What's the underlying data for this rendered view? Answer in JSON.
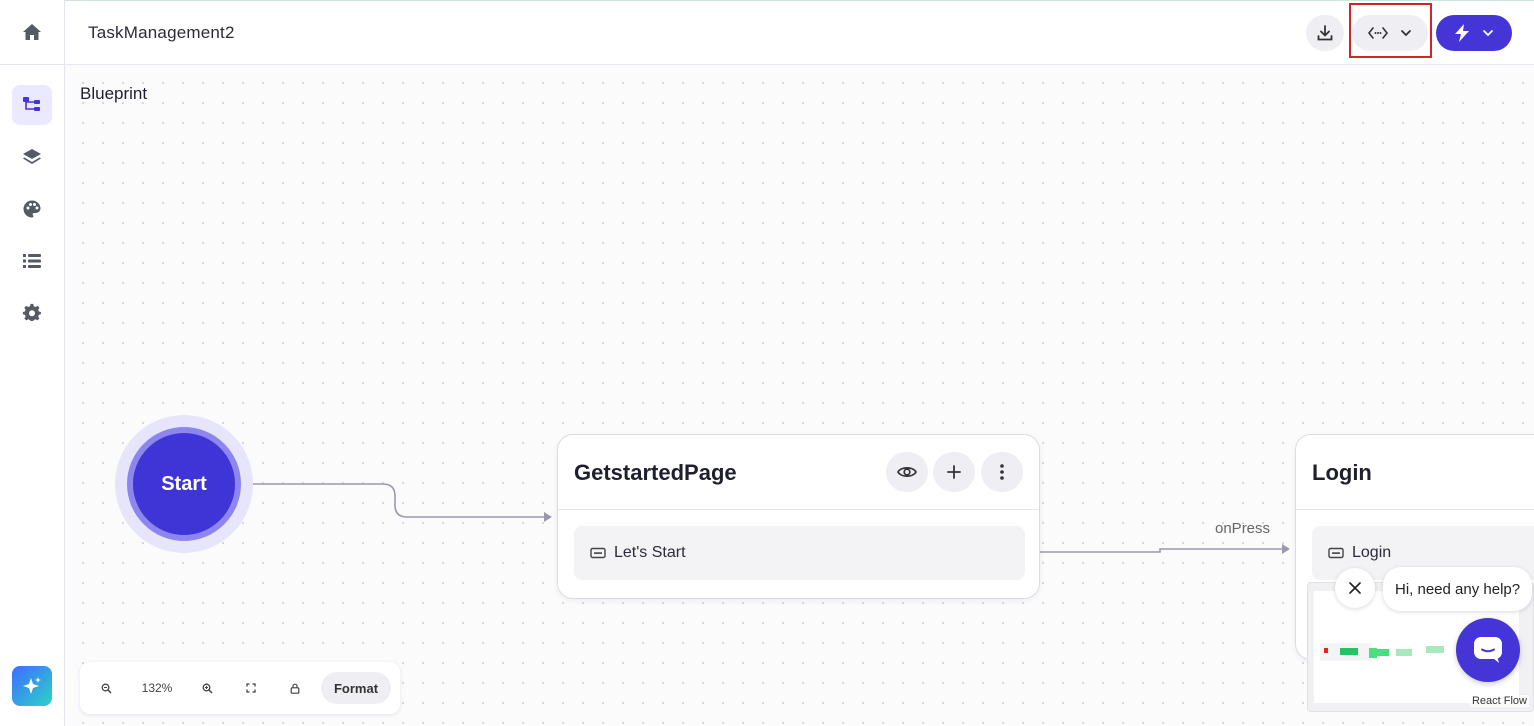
{
  "header": {
    "project_title": "TaskManagement2",
    "accent_color": "#4535d6"
  },
  "sidebar": {
    "items": [
      {
        "icon": "home-icon"
      },
      {
        "icon": "blueprint-icon",
        "active": true
      },
      {
        "icon": "layers-icon"
      },
      {
        "icon": "palette-icon"
      },
      {
        "icon": "list-icon"
      },
      {
        "icon": "gear-icon"
      },
      {
        "icon": "ai-sparkle-icon"
      }
    ]
  },
  "canvas": {
    "title": "Blueprint",
    "start_node": {
      "label": "Start"
    },
    "nodes": [
      {
        "title": "GetstartedPage",
        "row_label": "Let's Start"
      },
      {
        "title": "Login",
        "row_label": "Login"
      }
    ],
    "edge_label": "onPress"
  },
  "toolbar": {
    "zoom": "132%",
    "format_label": "Format"
  },
  "minimap": {
    "attribution": "React Flow"
  },
  "chat": {
    "message": "Hi, need any help?"
  }
}
